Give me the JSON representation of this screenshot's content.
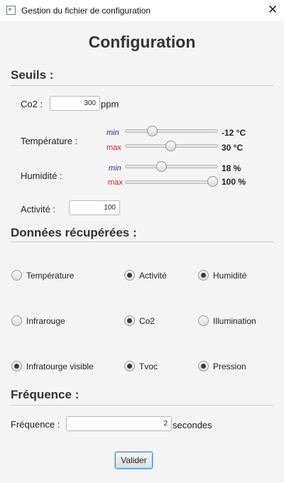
{
  "window": {
    "title": "Gestion du fichier de configuration",
    "close_glyph": "✕"
  },
  "heading": "Configuration",
  "seuils": {
    "title": "Seuils :",
    "co2": {
      "label": "Co2 :",
      "value": "300",
      "unit": "ppm"
    },
    "temperature": {
      "label": "Température :",
      "min_label": "min",
      "min_value": "-12 °C",
      "min_fraction": 0.27,
      "max_label": "max",
      "max_value": "30 °C",
      "max_fraction": 0.49
    },
    "humidite": {
      "label": "Humidité :",
      "min_label": "min",
      "min_value": "18 %",
      "min_fraction": 0.38,
      "max_label": "max",
      "max_value": "100 %",
      "max_fraction": 1.0
    },
    "activite": {
      "label": "Activité :",
      "value": "100"
    }
  },
  "donnees": {
    "title": "Données récupérées :",
    "options": [
      {
        "label": "Température",
        "checked": false
      },
      {
        "label": "Activité",
        "checked": true
      },
      {
        "label": "Humidité",
        "checked": true
      },
      {
        "label": "Infrarouge",
        "checked": false
      },
      {
        "label": "Co2",
        "checked": true
      },
      {
        "label": "Illumination",
        "checked": false
      },
      {
        "label": "Infratourge visible",
        "checked": true
      },
      {
        "label": "Tvoc",
        "checked": true
      },
      {
        "label": "Pression",
        "checked": true
      }
    ]
  },
  "frequence": {
    "title": "Fréquence :",
    "label": "Fréquence :",
    "value": "2",
    "unit": "secondes"
  },
  "submit_label": "Valider"
}
